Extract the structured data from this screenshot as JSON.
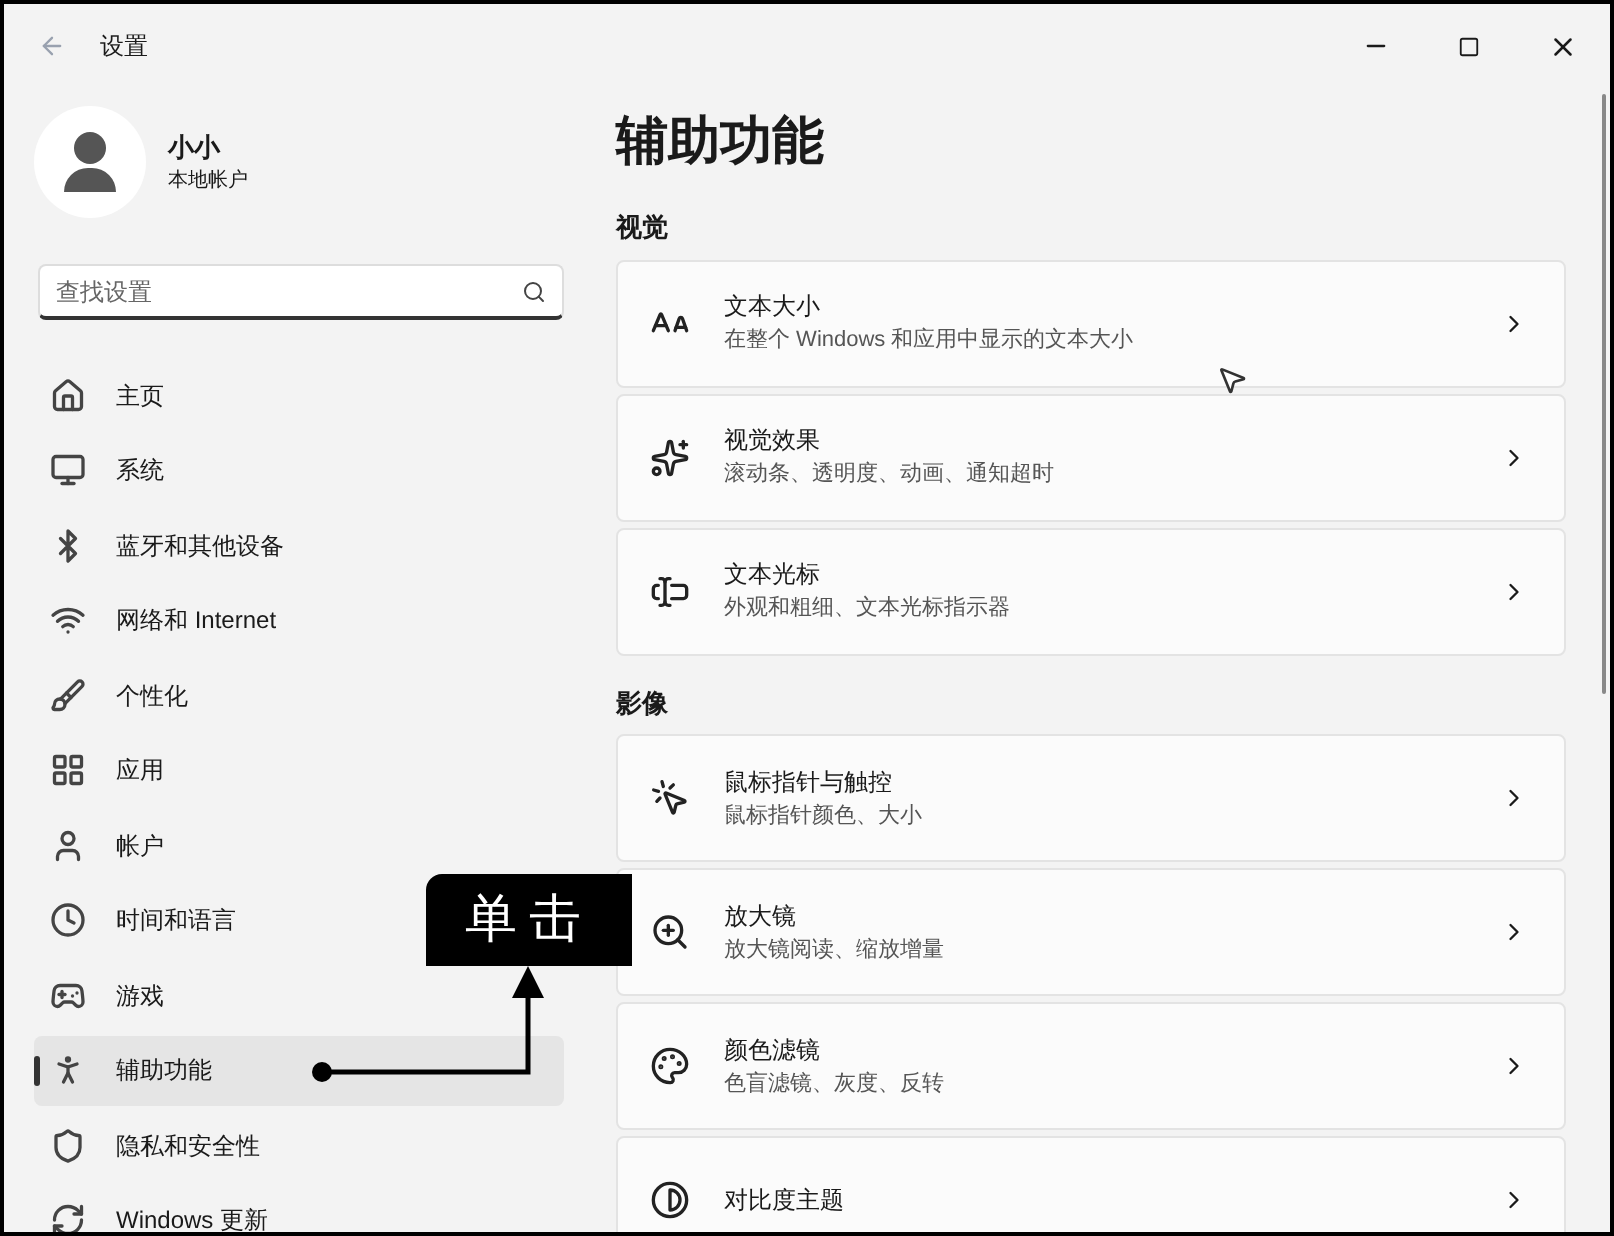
{
  "window": {
    "title": "设置"
  },
  "profile": {
    "name": "小小",
    "account": "本地帐户"
  },
  "search": {
    "placeholder": "查找设置"
  },
  "sidebar": {
    "items": [
      {
        "label": "主页",
        "selected": false
      },
      {
        "label": "系统",
        "selected": false
      },
      {
        "label": "蓝牙和其他设备",
        "selected": false
      },
      {
        "label": "网络和 Internet",
        "selected": false
      },
      {
        "label": "个性化",
        "selected": false
      },
      {
        "label": "应用",
        "selected": false
      },
      {
        "label": "帐户",
        "selected": false
      },
      {
        "label": "时间和语言",
        "selected": false
      },
      {
        "label": "游戏",
        "selected": false
      },
      {
        "label": "辅助功能",
        "selected": true
      },
      {
        "label": "隐私和安全性",
        "selected": false
      },
      {
        "label": "Windows 更新",
        "selected": false
      }
    ]
  },
  "page": {
    "title": "辅助功能",
    "sections": [
      {
        "title": "视觉",
        "cards": [
          {
            "title": "文本大小",
            "subtitle": "在整个 Windows 和应用中显示的文本大小"
          },
          {
            "title": "视觉效果",
            "subtitle": "滚动条、透明度、动画、通知超时"
          },
          {
            "title": "文本光标",
            "subtitle": "外观和粗细、文本光标指示器"
          }
        ]
      },
      {
        "title": "影像",
        "cards": [
          {
            "title": "鼠标指针与触控",
            "subtitle": "鼠标指针颜色、大小"
          },
          {
            "title": "放大镜",
            "subtitle": "放大镜阅读、缩放增量"
          },
          {
            "title": "颜色滤镜",
            "subtitle": "色盲滤镜、灰度、反转"
          },
          {
            "title": "对比度主题"
          }
        ]
      }
    ]
  },
  "callout": {
    "label": "单击"
  }
}
